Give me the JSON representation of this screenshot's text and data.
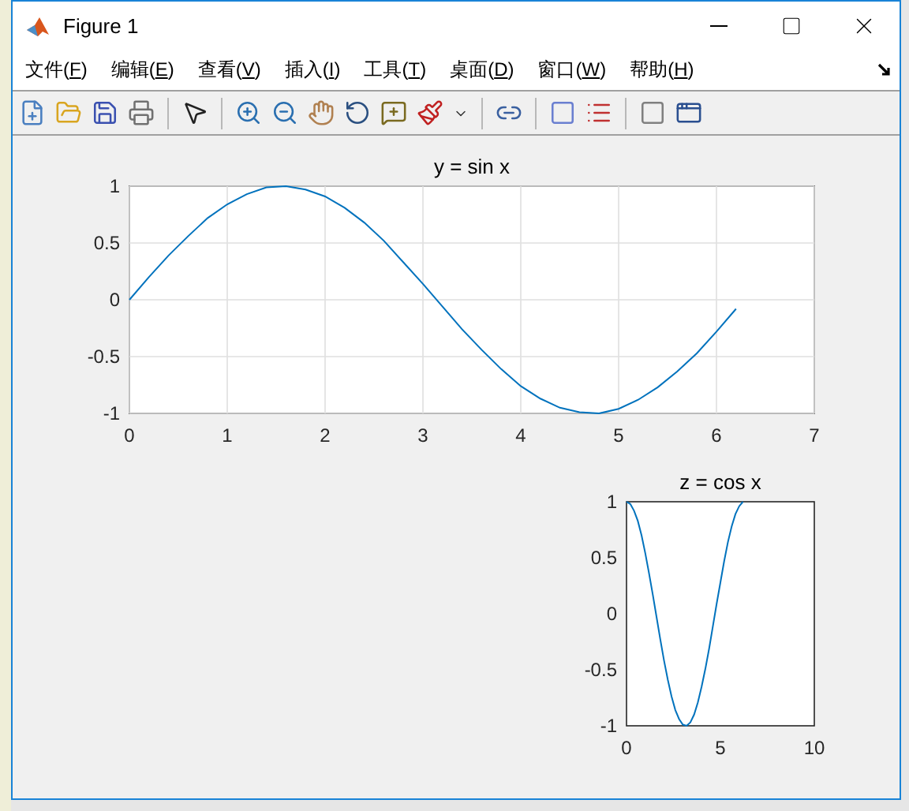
{
  "window": {
    "title": "Figure 1"
  },
  "menu": [
    {
      "label": "文件(F)"
    },
    {
      "label": "编辑(E)"
    },
    {
      "label": "查看(V)"
    },
    {
      "label": "插入(I)"
    },
    {
      "label": "工具(T)"
    },
    {
      "label": "桌面(D)"
    },
    {
      "label": "窗口(W)"
    },
    {
      "label": "帮助(H)"
    }
  ],
  "plots": [
    {
      "chart_data": {
        "type": "line",
        "title": "y = sin x",
        "grid": true,
        "x": [
          0,
          0.2,
          0.4,
          0.6,
          0.8,
          1.0,
          1.2,
          1.4,
          1.6,
          1.8,
          2.0,
          2.2,
          2.4,
          2.6,
          2.8,
          3.0,
          3.2,
          3.4,
          3.6,
          3.8,
          4.0,
          4.2,
          4.4,
          4.6,
          4.8,
          5.0,
          5.2,
          5.4,
          5.6,
          5.8,
          6.0,
          6.2
        ],
        "xlim": [
          0,
          7
        ],
        "ylim": [
          -1,
          1
        ],
        "xticks": [
          0,
          1,
          2,
          3,
          4,
          5,
          6,
          7
        ],
        "yticks": [
          -1,
          -0.5,
          0,
          0.5,
          1
        ],
        "series": [
          {
            "color": "#0072bd",
            "values": [
              0,
              0.2,
              0.39,
              0.56,
              0.72,
              0.84,
              0.93,
              0.99,
              1.0,
              0.97,
              0.91,
              0.81,
              0.68,
              0.52,
              0.33,
              0.14,
              -0.06,
              -0.26,
              -0.44,
              -0.61,
              -0.76,
              -0.87,
              -0.95,
              -0.99,
              -1.0,
              -0.96,
              -0.88,
              -0.77,
              -0.63,
              -0.47,
              -0.28,
              -0.08
            ]
          }
        ]
      }
    },
    {
      "chart_data": {
        "type": "line",
        "title": "z = cos x",
        "grid": false,
        "x": [
          0,
          0.2,
          0.4,
          0.6,
          0.8,
          1.0,
          1.2,
          1.4,
          1.6,
          1.8,
          2.0,
          2.2,
          2.4,
          2.6,
          2.8,
          3.0,
          3.2,
          3.4,
          3.6,
          3.8,
          4.0,
          4.2,
          4.4,
          4.6,
          4.8,
          5.0,
          5.2,
          5.4,
          5.6,
          5.8,
          6.0,
          6.2
        ],
        "xlim": [
          0,
          10
        ],
        "ylim": [
          -1,
          1
        ],
        "xticks": [
          0,
          5,
          10
        ],
        "yticks": [
          -1,
          -0.5,
          0,
          0.5,
          1
        ],
        "series": [
          {
            "color": "#0072bd",
            "values": [
              1,
              0.98,
              0.92,
              0.83,
              0.7,
              0.54,
              0.36,
              0.17,
              -0.03,
              -0.23,
              -0.42,
              -0.59,
              -0.74,
              -0.86,
              -0.94,
              -0.99,
              -1.0,
              -0.97,
              -0.9,
              -0.79,
              -0.65,
              -0.49,
              -0.31,
              -0.11,
              0.09,
              0.28,
              0.47,
              0.64,
              0.78,
              0.89,
              0.96,
              1.0
            ]
          }
        ]
      }
    }
  ]
}
